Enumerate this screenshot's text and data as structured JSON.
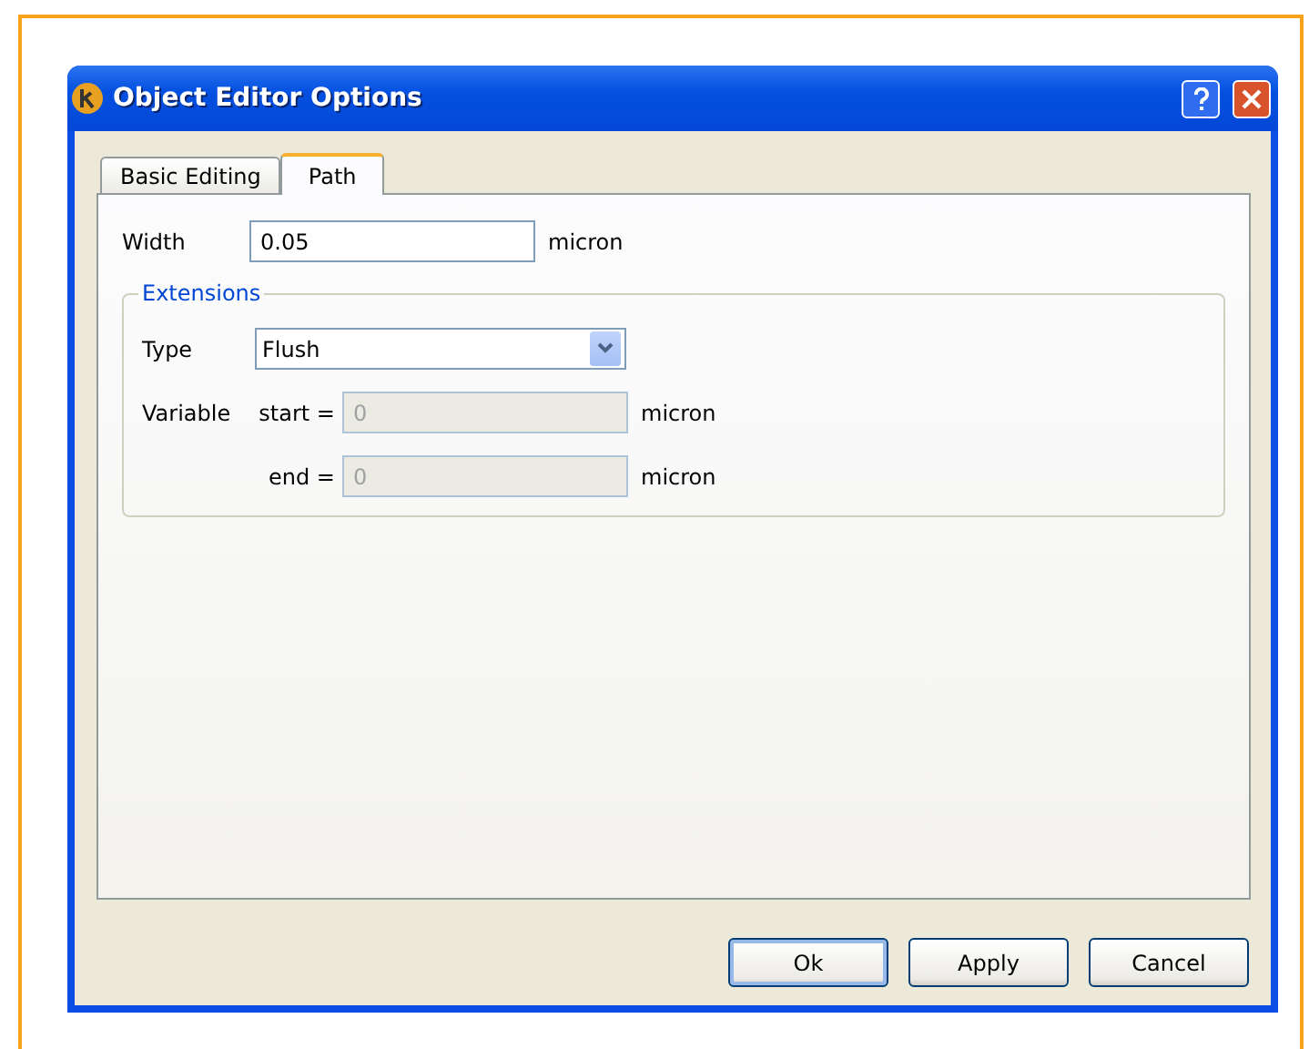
{
  "window": {
    "title": "Object Editor Options"
  },
  "tabs": [
    {
      "label": "Basic Editing",
      "selected": false
    },
    {
      "label": "Path",
      "selected": true
    }
  ],
  "width": {
    "label": "Width",
    "value": "0.05",
    "unit": "micron"
  },
  "extensions": {
    "title": "Extensions",
    "type": {
      "label": "Type",
      "value": "Flush"
    },
    "variable_label": "Variable",
    "fields": [
      {
        "label": "start =",
        "value": "0",
        "unit": "micron",
        "disabled": true
      },
      {
        "label": "end =",
        "value": "0",
        "unit": "micron",
        "disabled": true
      }
    ]
  },
  "buttons": [
    {
      "label": "Ok",
      "default": true
    },
    {
      "label": "Apply",
      "default": false
    },
    {
      "label": "Cancel",
      "default": false
    }
  ]
}
